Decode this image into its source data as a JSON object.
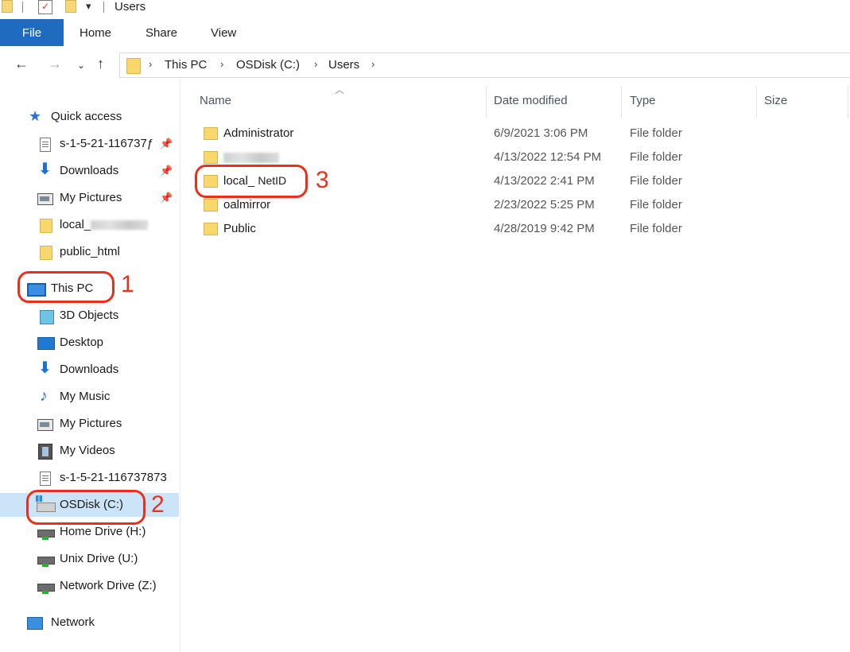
{
  "window": {
    "title": "Users"
  },
  "ribbon": {
    "tabs": [
      "File",
      "Home",
      "Share",
      "View"
    ]
  },
  "address": {
    "crumbs": [
      "This PC",
      "OSDisk (C:)",
      "Users"
    ]
  },
  "nav": {
    "quick_access": {
      "label": "Quick access",
      "items": [
        {
          "label": "s-1-5-21-116737ƒ",
          "icon": "document-icon",
          "pinned": true
        },
        {
          "label": "Downloads",
          "icon": "download-arrow-icon",
          "pinned": true
        },
        {
          "label": "My Pictures",
          "icon": "pictures-icon",
          "pinned": true
        },
        {
          "label": "local_",
          "icon": "folder-icon",
          "pinned": false,
          "redacted": true
        },
        {
          "label": "public_html",
          "icon": "folder-icon",
          "pinned": false
        }
      ]
    },
    "this_pc": {
      "label": "This PC",
      "items": [
        {
          "label": "3D Objects",
          "icon": "3d-objects-icon"
        },
        {
          "label": "Desktop",
          "icon": "desktop-icon"
        },
        {
          "label": "Downloads",
          "icon": "download-arrow-icon"
        },
        {
          "label": "My Music",
          "icon": "music-note-icon"
        },
        {
          "label": "My Pictures",
          "icon": "pictures-icon"
        },
        {
          "label": "My Videos",
          "icon": "videos-icon"
        },
        {
          "label": "s-1-5-21-116737873",
          "icon": "document-icon"
        },
        {
          "label": "OSDisk (C:)",
          "icon": "os-disk-icon",
          "selected": true
        },
        {
          "label": "Home Drive (H:)",
          "icon": "network-drive-icon"
        },
        {
          "label": "Unix Drive (U:)",
          "icon": "network-drive-icon"
        },
        {
          "label": "Network Drive (Z:)",
          "icon": "network-drive-icon"
        }
      ]
    },
    "network": {
      "label": "Network"
    }
  },
  "columns": [
    "Name",
    "Date modified",
    "Type",
    "Size"
  ],
  "files": [
    {
      "name": "Administrator",
      "date": "6/9/2021 3:06 PM",
      "type": "File folder"
    },
    {
      "name": "",
      "redacted": true,
      "date": "4/13/2022 12:54 PM",
      "type": "File folder"
    },
    {
      "name": "local_",
      "annotation": "NetID",
      "date": "4/13/2022 2:41 PM",
      "type": "File folder"
    },
    {
      "name": "oalmirror",
      "date": "2/23/2022 5:25 PM",
      "type": "File folder"
    },
    {
      "name": "Public",
      "date": "4/28/2019 9:42 PM",
      "type": "File folder"
    }
  ],
  "annotations": {
    "n1": "1",
    "n2": "2",
    "n3": "3",
    "color": "#e8301c"
  }
}
